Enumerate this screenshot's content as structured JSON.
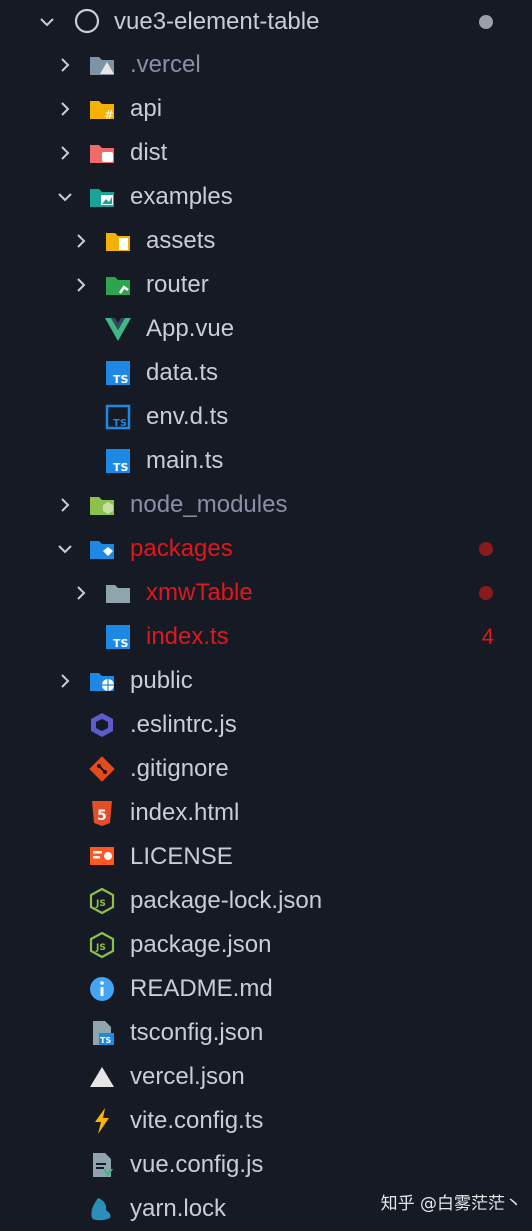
{
  "explorer": {
    "root": {
      "label": "vue3-element-table",
      "expanded": true,
      "modified": true
    },
    "items": [
      {
        "label": ".vercel",
        "type": "folder",
        "expanded": false,
        "depth": 1,
        "icon": "vercel-folder-icon",
        "color": "#7f93a6",
        "dim": true
      },
      {
        "label": "api",
        "type": "folder",
        "expanded": false,
        "depth": 1,
        "icon": "api-folder-icon",
        "color": "#f5b100"
      },
      {
        "label": "dist",
        "type": "folder",
        "expanded": false,
        "depth": 1,
        "icon": "dist-folder-icon",
        "color": "#f06a6a"
      },
      {
        "label": "examples",
        "type": "folder",
        "expanded": true,
        "depth": 1,
        "icon": "examples-folder-icon",
        "color": "#1aa39a"
      },
      {
        "label": "assets",
        "type": "folder",
        "expanded": false,
        "depth": 2,
        "icon": "assets-folder-icon",
        "color": "#f5b100"
      },
      {
        "label": "router",
        "type": "folder",
        "expanded": false,
        "depth": 2,
        "icon": "router-folder-icon",
        "color": "#2ea44f"
      },
      {
        "label": "App.vue",
        "type": "file",
        "depth": 2,
        "icon": "vue-icon",
        "color": "#41b883"
      },
      {
        "label": "data.ts",
        "type": "file",
        "depth": 2,
        "icon": "typescript-icon",
        "color": "#1e88e5"
      },
      {
        "label": "env.d.ts",
        "type": "file",
        "depth": 2,
        "icon": "typescript-def-icon",
        "color": "#1e88e5"
      },
      {
        "label": "main.ts",
        "type": "file",
        "depth": 2,
        "icon": "typescript-icon",
        "color": "#1e88e5"
      },
      {
        "label": "node_modules",
        "type": "folder",
        "expanded": false,
        "depth": 1,
        "icon": "node-modules-folder-icon",
        "color": "#8bc34a",
        "dim": true
      },
      {
        "label": "packages",
        "type": "folder",
        "expanded": true,
        "depth": 1,
        "icon": "packages-folder-icon",
        "color": "#1e88e5",
        "error": true,
        "dot": true
      },
      {
        "label": "xmwTable",
        "type": "folder",
        "expanded": false,
        "depth": 2,
        "icon": "folder-icon",
        "color": "#90a4ae",
        "error": true,
        "dot": true
      },
      {
        "label": "index.ts",
        "type": "file",
        "depth": 2,
        "icon": "typescript-icon",
        "color": "#1e88e5",
        "error": true,
        "badge": "4"
      },
      {
        "label": "public",
        "type": "folder",
        "expanded": false,
        "depth": 1,
        "icon": "public-folder-icon",
        "color": "#1e88e5"
      },
      {
        "label": ".eslintrc.js",
        "type": "file",
        "depth": 1,
        "icon": "eslint-icon",
        "color": "#5c5ccc"
      },
      {
        "label": ".gitignore",
        "type": "file",
        "depth": 1,
        "icon": "git-icon",
        "color": "#e64a19"
      },
      {
        "label": "index.html",
        "type": "file",
        "depth": 1,
        "icon": "html5-icon",
        "color": "#e44d26"
      },
      {
        "label": "LICENSE",
        "type": "file",
        "depth": 1,
        "icon": "license-icon",
        "color": "#ff5722"
      },
      {
        "label": "package-lock.json",
        "type": "file",
        "depth": 1,
        "icon": "nodejs-icon",
        "color": "#8bc34a"
      },
      {
        "label": "package.json",
        "type": "file",
        "depth": 1,
        "icon": "nodejs-icon",
        "color": "#8bc34a"
      },
      {
        "label": "README.md",
        "type": "file",
        "depth": 1,
        "icon": "info-icon",
        "color": "#42a5f5"
      },
      {
        "label": "tsconfig.json",
        "type": "file",
        "depth": 1,
        "icon": "tsconfig-icon",
        "color": "#90a4ae"
      },
      {
        "label": "vercel.json",
        "type": "file",
        "depth": 1,
        "icon": "vercel-icon",
        "color": "#e6e6e6"
      },
      {
        "label": "vite.config.ts",
        "type": "file",
        "depth": 1,
        "icon": "vite-icon",
        "color": "#ffb300"
      },
      {
        "label": "vue.config.js",
        "type": "file",
        "depth": 1,
        "icon": "vue-config-icon",
        "color": "#90a4ae"
      },
      {
        "label": "yarn.lock",
        "type": "file",
        "depth": 1,
        "icon": "yarn-icon",
        "color": "#2c8ebb"
      }
    ]
  },
  "watermark": "知乎 @白雾茫茫丶",
  "colors": {
    "background": "#161a24",
    "text": "#c9cdd6",
    "dim": "#8a8fa8",
    "error": "#e0171c",
    "dot": "#8b1a1d"
  }
}
